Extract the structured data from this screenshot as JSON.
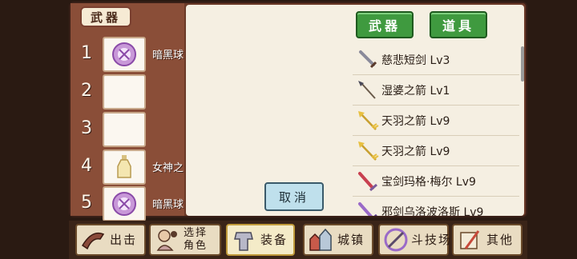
{
  "category_label": "武器",
  "slots": [
    {
      "number": "1",
      "name": "暗黑球",
      "icon": "dark-orb-icon"
    },
    {
      "number": "2",
      "name": "",
      "icon": ""
    },
    {
      "number": "3",
      "name": "",
      "icon": ""
    },
    {
      "number": "4",
      "name": "女神之",
      "icon": "goddess-bottle-icon"
    },
    {
      "number": "5",
      "name": "暗黑球",
      "icon": "dark-orb-icon"
    }
  ],
  "tabs": {
    "weapons": "武器",
    "items": "道具"
  },
  "item_list": [
    {
      "name": "慈悲短剑 Lv3",
      "icon": "dagger-icon"
    },
    {
      "name": "湿婆之箭 Lv1",
      "icon": "arrow-icon"
    },
    {
      "name": "天羽之箭 Lv9",
      "icon": "feather-arrow-icon"
    },
    {
      "name": "天羽之箭 Lv9",
      "icon": "feather-arrow-icon"
    },
    {
      "name": "宝剑玛格·梅尔 Lv9",
      "icon": "red-sword-icon"
    },
    {
      "name": "邪剑乌洛波洛斯 Lv9",
      "icon": "purple-sword-icon"
    }
  ],
  "cancel_label": "取消",
  "nav": {
    "sortie": "出击",
    "select_char_line1": "选择",
    "select_char_line2": "角色",
    "equip": "装备",
    "town": "城镇",
    "arena": "斗技场",
    "other": "其他"
  },
  "colors": {
    "tab_green": "#3f9a3f",
    "panel_bg": "#f5efe2",
    "frame_brown": "#6b3a28"
  }
}
